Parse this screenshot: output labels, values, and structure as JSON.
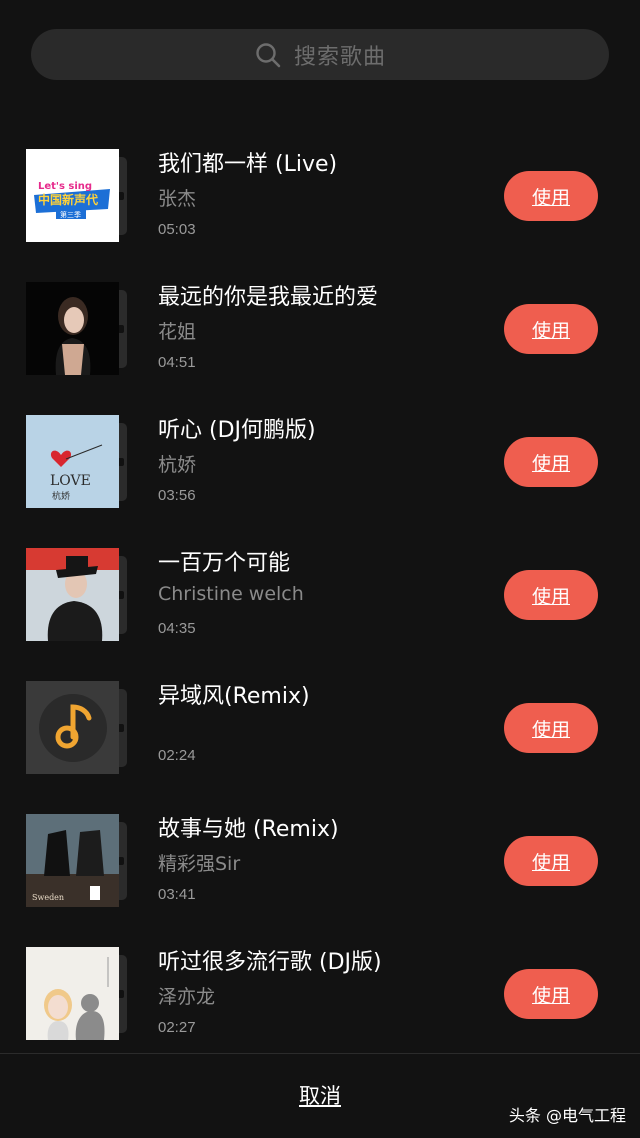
{
  "search": {
    "placeholder": "搜索歌曲",
    "icon": "search-icon"
  },
  "songs": [
    {
      "title": "我们都一样 (Live)",
      "artist": "张杰",
      "duration": "05:03",
      "action": "使用",
      "cover_text": "Let's sing 中国新声代 第三季"
    },
    {
      "title": "最远的你是我最近的爱",
      "artist": "花姐",
      "duration": "04:51",
      "action": "使用"
    },
    {
      "title": "听心 (DJ何鹏版)",
      "artist": "杭娇",
      "duration": "03:56",
      "action": "使用",
      "cover_text": "LOVE 杭娇"
    },
    {
      "title": "一百万个可能",
      "artist": "Christine welch",
      "duration": "04:35",
      "action": "使用"
    },
    {
      "title": "异域风(Remix)",
      "artist": "",
      "duration": "02:24",
      "action": "使用"
    },
    {
      "title": "故事与她 (Remix)",
      "artist": "精彩强Sir",
      "duration": "03:41",
      "action": "使用"
    },
    {
      "title": "听过很多流行歌 (DJ版)",
      "artist": "泽亦龙",
      "duration": "02:27",
      "action": "使用"
    }
  ],
  "footer": {
    "cancel_label": "取消"
  },
  "watermark": "头条 @电气工程",
  "colors": {
    "background": "#121212",
    "search_bg": "#2a2a2a",
    "accent_button": "#ef5e4f",
    "secondary_text": "#8a8a8a",
    "default_cover_note": "#f0a531"
  }
}
